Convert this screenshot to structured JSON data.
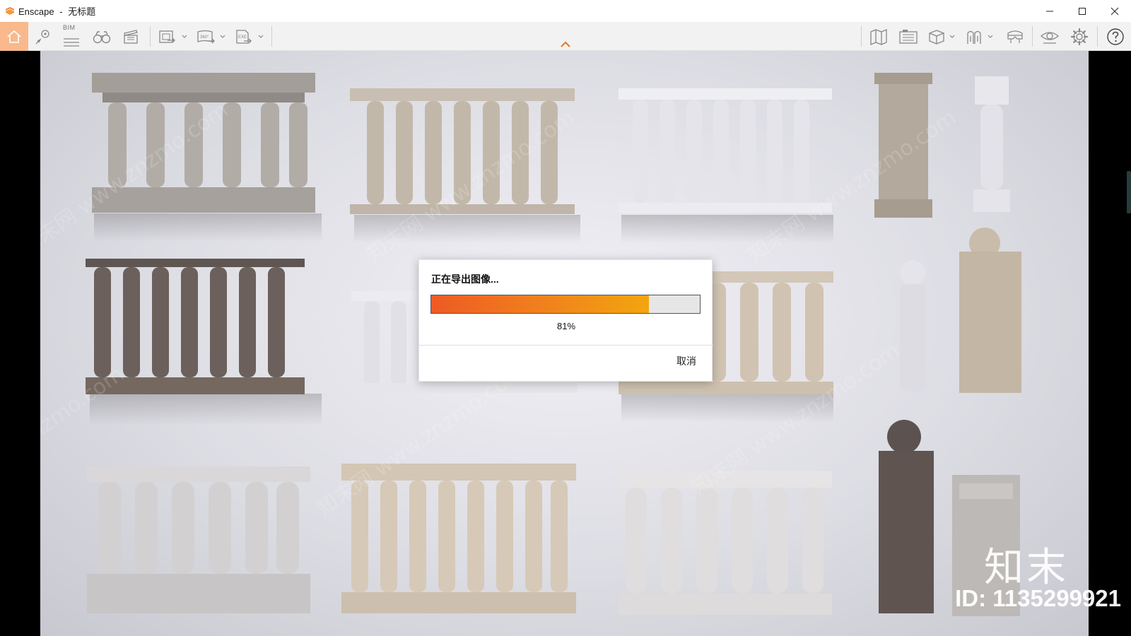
{
  "window": {
    "app_name": "Enscape",
    "separator": "-",
    "document_title": "无标题",
    "controls": [
      "minimize-icon",
      "maximize-icon",
      "close-icon"
    ]
  },
  "toolbar": {
    "left": [
      "home-icon",
      "views-icon",
      "bim-icon",
      "binoculars-icon",
      "video-editor-icon",
      "render-image-icon",
      "render-panorama-icon",
      "export-exe-icon"
    ],
    "bim_label": "BIM",
    "center": [
      "collapse-chevron-icon"
    ],
    "right": [
      "map-icon",
      "screenshot-batch-icon",
      "cube-icon",
      "asset-library-icon",
      "vr-headset-icon",
      "visual-settings-icon",
      "settings-gear-icon",
      "help-icon"
    ],
    "accent_color": "#f07a20",
    "home_active_bg": "#f9b98c"
  },
  "viewport": {
    "content": "balustrade-render",
    "watermark_text": "知末",
    "watermark_id": "ID: 1135299921"
  },
  "dialog": {
    "title": "正在导出图像...",
    "progress_percent": 81,
    "progress_text": "81%",
    "cancel_label": "取消",
    "progress_colors": [
      "#ee5a24",
      "#f3a50f"
    ]
  }
}
